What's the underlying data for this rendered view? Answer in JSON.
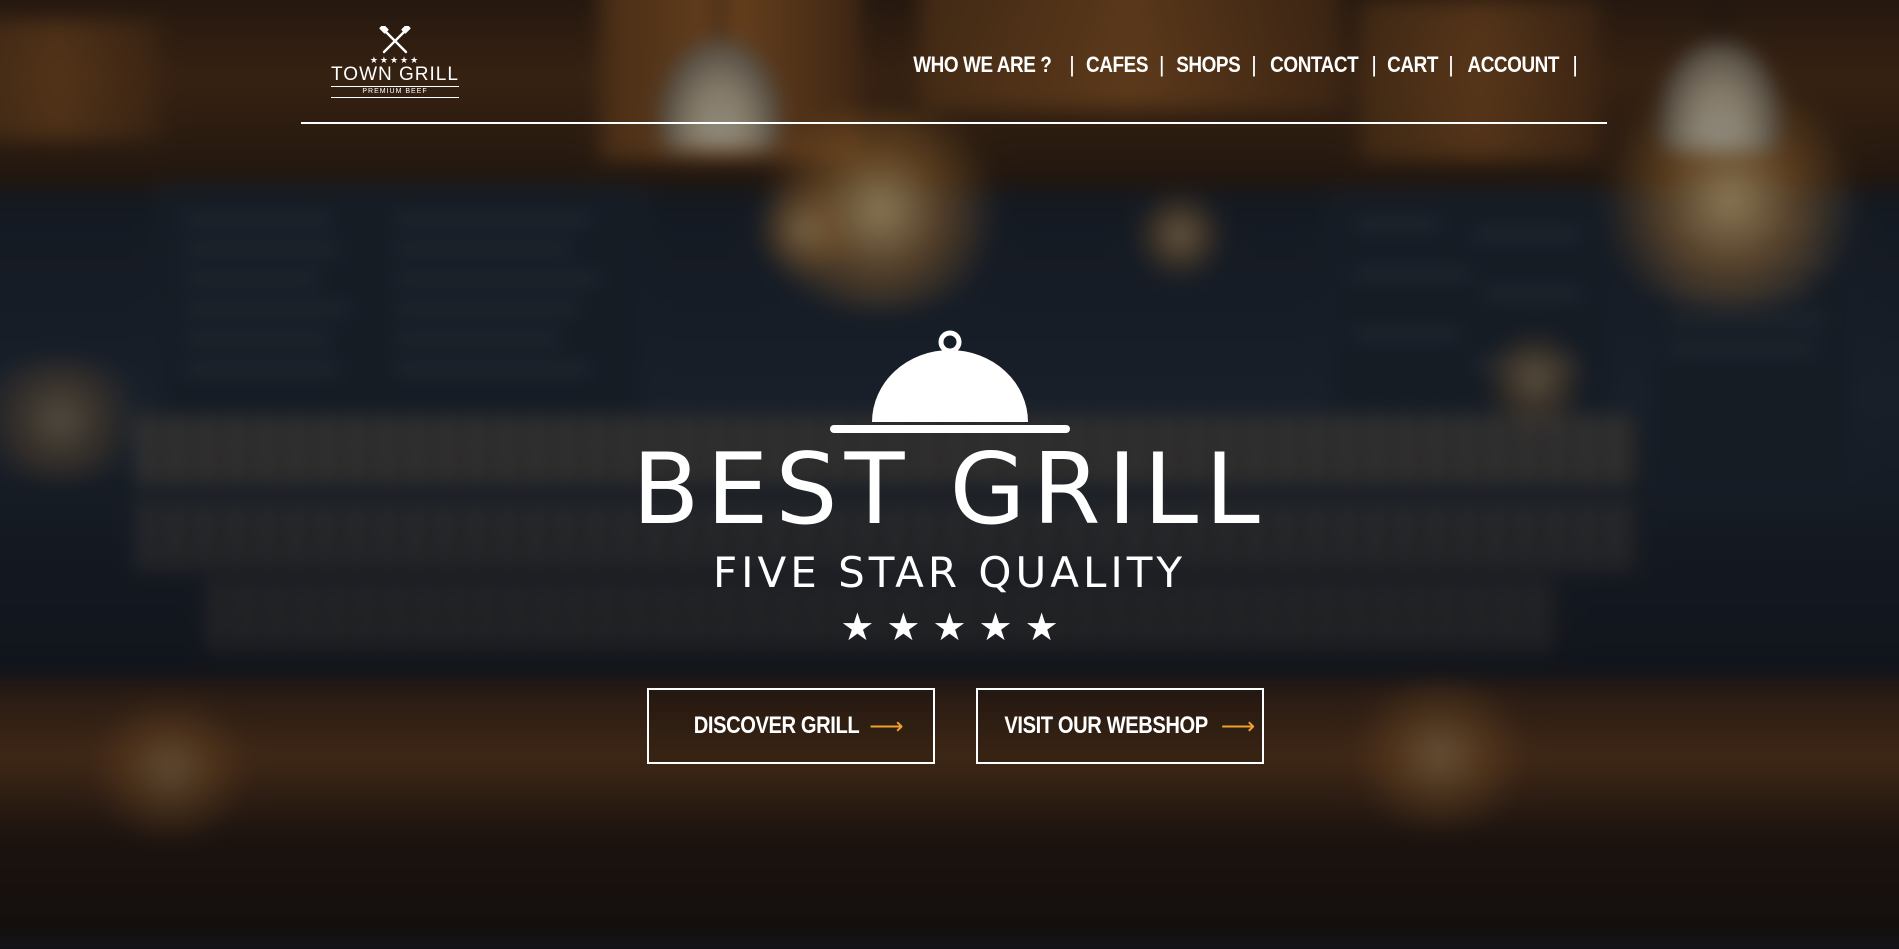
{
  "brand": {
    "stars": "★★★★★",
    "name": "TOWN GRILL",
    "tagline": "PREMIUM BEEF"
  },
  "nav": {
    "items": [
      {
        "label": "WHO WE ARE ?"
      },
      {
        "label": "CAFES"
      },
      {
        "label": "SHOPS"
      },
      {
        "label": "CONTACT"
      },
      {
        "label": "CART"
      },
      {
        "label": "ACCOUNT"
      }
    ],
    "separator": "|"
  },
  "hero": {
    "title": "BEST GRILL",
    "subtitle": "FIVE STAR QUALITY",
    "stars": "★★★★★"
  },
  "buttons": {
    "discover_label": "DISCOVER GRILL",
    "webshop_label": "VISIT OUR WEBSHOP",
    "arrow": "⟶"
  },
  "colors": {
    "accent": "#f0a030",
    "text": "#ffffff"
  },
  "icons": {
    "logo": "crossed-utensils-icon",
    "hero": "cloche-icon",
    "button_arrow": "arrow-right-icon"
  }
}
